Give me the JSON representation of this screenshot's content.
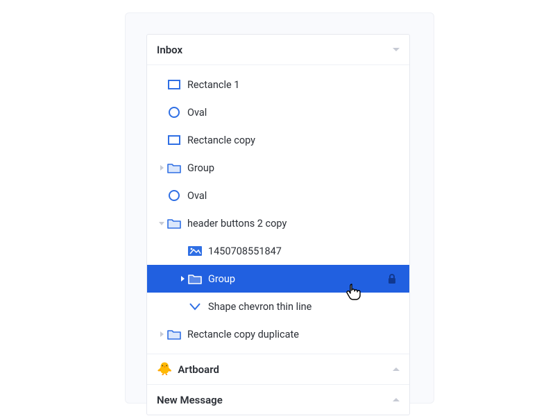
{
  "sections": {
    "inbox": {
      "title": "Inbox"
    },
    "artboard": {
      "title": "Artboard"
    },
    "new_message": {
      "title": "New Message"
    }
  },
  "tree": [
    {
      "label": "Rectancle 1",
      "icon": "rectangle",
      "depth": 0,
      "disclosure": "none",
      "selected": false
    },
    {
      "label": "Oval",
      "icon": "oval",
      "depth": 0,
      "disclosure": "none",
      "selected": false
    },
    {
      "label": "Rectancle copy",
      "icon": "rectangle",
      "depth": 0,
      "disclosure": "none",
      "selected": false
    },
    {
      "label": "Group",
      "icon": "folder",
      "depth": 0,
      "disclosure": "closed",
      "selected": false
    },
    {
      "label": "Oval",
      "icon": "oval",
      "depth": 0,
      "disclosure": "none",
      "selected": false
    },
    {
      "label": "header buttons 2 copy",
      "icon": "folder",
      "depth": 0,
      "disclosure": "open",
      "selected": false
    },
    {
      "label": "1450708551847",
      "icon": "image",
      "depth": 1,
      "disclosure": "none",
      "selected": false
    },
    {
      "label": "Group",
      "icon": "folder",
      "depth": 1,
      "disclosure": "closed",
      "selected": true,
      "locked": true
    },
    {
      "label": "Shape chevron thin line",
      "icon": "chevron",
      "depth": 1,
      "disclosure": "none",
      "selected": false
    },
    {
      "label": "Rectancle copy duplicate",
      "icon": "folder",
      "depth": 0,
      "disclosure": "closed",
      "selected": false
    }
  ],
  "colors": {
    "accent": "#2160e0",
    "iconBlue": "#2f6fe4"
  }
}
